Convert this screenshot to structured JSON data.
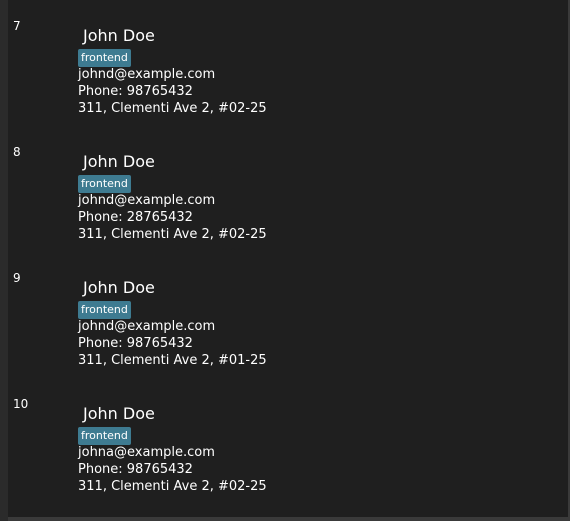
{
  "persons": [
    {
      "index": "7",
      "name": "John Doe",
      "tag": "frontend",
      "email": "johnd@example.com",
      "phone": "Phone: 98765432",
      "address": "311, Clementi Ave 2, #02-25"
    },
    {
      "index": "8",
      "name": "John Doe",
      "tag": "frontend",
      "email": "johnd@example.com",
      "phone": "Phone: 28765432",
      "address": "311, Clementi Ave 2, #02-25"
    },
    {
      "index": "9",
      "name": "John Doe",
      "tag": "frontend",
      "email": "johnd@example.com",
      "phone": "Phone: 98765432",
      "address": "311, Clementi Ave 2, #01-25"
    },
    {
      "index": "10",
      "name": "John Doe",
      "tag": "frontend",
      "email": "johna@example.com",
      "phone": "Phone: 98765432",
      "address": "311, Clementi Ave 2, #02-25"
    }
  ],
  "colors": {
    "background": "#1f1f1f",
    "tag_background": "#3e7b91",
    "text": "#ffffff"
  }
}
